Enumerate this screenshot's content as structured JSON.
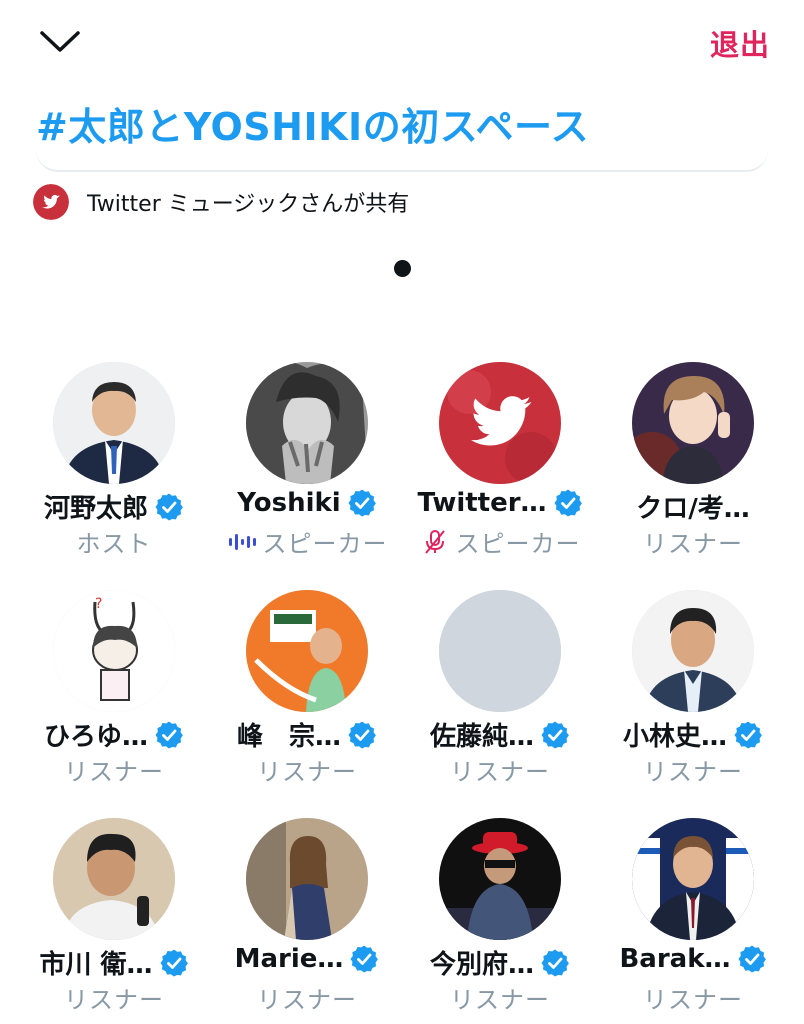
{
  "header": {
    "collapse_icon": "chevron-down-icon",
    "leave_label": "退出",
    "title": "#太郎とYOSHIKIの初スペース"
  },
  "shared": {
    "text": "Twitter ミュージックさんが共有",
    "icon": "twitter-bird-icon"
  },
  "colors": {
    "accent": "#1d9bf0",
    "leave": "#e0245e",
    "muted": "#8899a6",
    "badge": "#1d9bf0",
    "speaking": "#3b4fd6"
  },
  "participants": [
    {
      "name": "河野太郎",
      "role": "ホスト",
      "verified": true,
      "status": ""
    },
    {
      "name": "Yoshiki",
      "role": "スピーカー",
      "verified": true,
      "status": "speaking"
    },
    {
      "name": "Twitter…",
      "role": "スピーカー",
      "verified": true,
      "status": "muted"
    },
    {
      "name": "クロ/考…",
      "role": "リスナー",
      "verified": false,
      "status": ""
    },
    {
      "name": "ひろゆ…",
      "role": "リスナー",
      "verified": true,
      "status": ""
    },
    {
      "name": "峰　宗…",
      "role": "リスナー",
      "verified": true,
      "status": ""
    },
    {
      "name": "佐藤純…",
      "role": "リスナー",
      "verified": true,
      "status": ""
    },
    {
      "name": "小林史…",
      "role": "リスナー",
      "verified": true,
      "status": ""
    },
    {
      "name": "市川 衛…",
      "role": "リスナー",
      "verified": true,
      "status": ""
    },
    {
      "name": "Marie…",
      "role": "リスナー",
      "verified": true,
      "status": ""
    },
    {
      "name": "今別府…",
      "role": "リスナー",
      "verified": true,
      "status": ""
    },
    {
      "name": "Barak…",
      "role": "リスナー",
      "verified": true,
      "status": ""
    }
  ]
}
